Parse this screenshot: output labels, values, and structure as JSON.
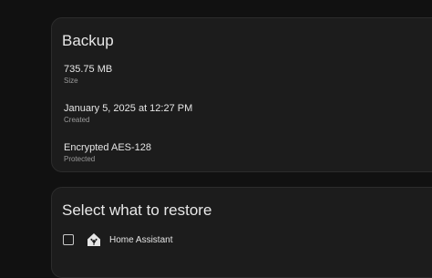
{
  "backup": {
    "title": "Backup",
    "size_value": "735.75 MB",
    "size_label": "Size",
    "created_value": "January 5, 2025 at 12:27 PM",
    "created_label": "Created",
    "encryption_value": "Encrypted AES-128",
    "encryption_label": "Protected"
  },
  "restore": {
    "title": "Select what to restore",
    "items": [
      {
        "label": "Home Assistant",
        "icon": "home-assistant-icon",
        "checked": false
      }
    ]
  },
  "colors": {
    "background": "#111111",
    "card": "#1c1c1c",
    "text": "#e1e1e1",
    "secondary_text": "#9a9a9a"
  }
}
